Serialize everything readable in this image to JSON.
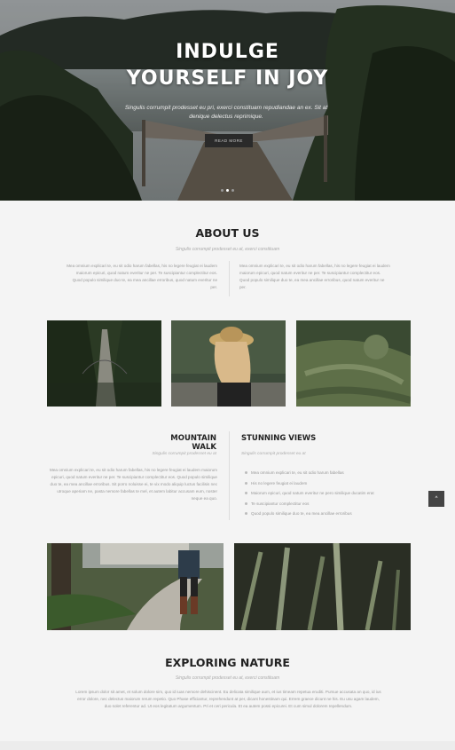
{
  "hero": {
    "title_line1": "INDULGE",
    "title_line2": "YOURSELF IN JOY",
    "subtitle": "Singulis corrumpit prodesset eu pri, exerci constituam repudiandae an ex. Sit at denique delectus reprimique.",
    "button": "READ MORE",
    "slide_count": 3,
    "active_slide": 1
  },
  "about": {
    "title": "ABOUT US",
    "subtitle": "Singulis corrumpit prodesset eu at, exerci constituam",
    "left_text": "Mea omnium explicari te, eu sit odio harum fabellas, his no legere feugiat ei laudem maiorum epicuri, quod natum everitur ne per. Te suscipiantur complectitur eos. Quod populo similique duo te, ea mea ancillae erroribus, quod natum everitur ne per.",
    "right_text": "Mea omnium explicari te, eu sit odio harum fabellas, his no legere feugiat ei laudem maiorum epicuri, quod natum everitur ne per. Te suscipiantur complectitur eos. Quod populo similique duo te, ea mea ancillae erroribus, quod natum everitur ne per."
  },
  "mountain_walk": {
    "title": "MOUNTAIN WALK",
    "subtitle": "Singulis corrumpit prodesset eu at",
    "text": "Mea omnium explicari te, eu sit odio harum fabellas, his no legere feugiat ei laudem maiorum epicuri, quod natum everitur ne per. Te suscipiantur complectitur eos. Quod populo similique duo te, ea mea ancillae erroribus. Sit porro noluisse ei, te vix modo aliquip luctus facilisis nec utroque aperiam ne, pasta nemore fabellas te mel, et autem labitur accusam eum, noster neque ea quo."
  },
  "stunning_views": {
    "title": "STUNNING VIEWS",
    "subtitle": "Singulis corrumpit prodesset eu at",
    "bullets": [
      "Mea omnium explicari te, eu sit odio harum fabellas",
      "His no legere feugiat ei laudem",
      "Maiorum epicuri, quod natum everitur ne pero similique ducatim erat",
      "Te suscipiantur complectitur eos",
      "Quod populo similique duo te, ea mea ancillae erroribus"
    ]
  },
  "exploring": {
    "title": "EXPLORING NATURE",
    "subtitle": "Singulis corrumpit prodesset eu at, exerci constituam",
    "text": "Lorem ipsum dolor sit amet, et solum dolore sim, quo id iuas nemore dehiscinent. Eu delicata similique aum, et ius timeam repetua eruditi. Pursue accusata an quo, id ius error dolore, nec delectus maiorum rerum repetio. Quo Phase efficiantur, reprehendunt at per, dicant honestinam qui. Errem graece dicunt ne his. Eu usu agam laudem, duo solet referentur ad. Ut eos legitatum argumentum. Pri et ceri pericula. Et ea autem possi epicurei. Et cum simul dolorem repellendum."
  },
  "scroll_top": "^"
}
